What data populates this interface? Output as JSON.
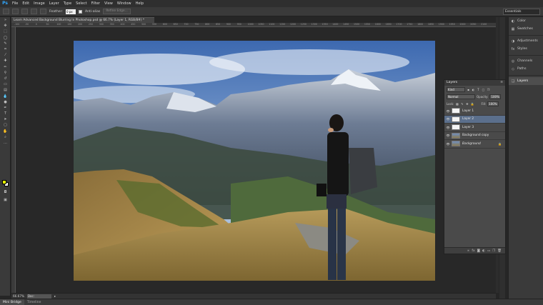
{
  "app": {
    "logo": "Ps",
    "menu": [
      "File",
      "Edit",
      "Image",
      "Layer",
      "Type",
      "Select",
      "Filter",
      "View",
      "Window",
      "Help"
    ]
  },
  "options": {
    "feather_label": "Feather:",
    "feather_value": "0 px",
    "antialias_label": "Anti-alias",
    "refine_label": "Refine Edge...",
    "workspace": "Essentials"
  },
  "document": {
    "tab_title": "Learn Advanced Background Blurring In Photoshop.psd @ 66.7% (Layer 1, RGB/8#) *",
    "ruler_ticks": [
      "-100",
      "-50",
      "0",
      "50",
      "100",
      "150",
      "200",
      "250",
      "300",
      "350",
      "400",
      "450",
      "500",
      "550",
      "600",
      "650",
      "700",
      "750",
      "800",
      "850",
      "900",
      "950",
      "1000",
      "1050",
      "1100",
      "1150",
      "1200",
      "1250",
      "1300",
      "1350",
      "1400",
      "1450",
      "1500",
      "1550",
      "1600",
      "1650",
      "1700",
      "1750",
      "1800",
      "1850",
      "1900",
      "1950",
      "2000",
      "2050",
      "2100"
    ]
  },
  "status": {
    "zoom": "66.67%",
    "doc": "Doc: 7.03M/22.1M"
  },
  "bottom_tabs": [
    "Mini Bridge",
    "Timeline"
  ],
  "dock": {
    "groups": [
      [
        "Color",
        "Swatches"
      ],
      [
        "Adjustments",
        "Styles"
      ],
      [
        "Channels",
        "Paths"
      ],
      [
        "Layers"
      ]
    ]
  },
  "layers": {
    "title": "Layers",
    "filter_kind": "Kind",
    "blend_mode": "Normal",
    "opacity_label": "Opacity:",
    "opacity_value": "100%",
    "lock_label": "Lock:",
    "fill_label": "Fill:",
    "fill_value": "100%",
    "items": [
      {
        "name": "Layer 1"
      },
      {
        "name": "Layer 2"
      },
      {
        "name": "Layer 3"
      },
      {
        "name": "Background copy"
      },
      {
        "name": "Background"
      }
    ]
  },
  "colors": {
    "foreground": "#e3f000",
    "background": "#ffffff",
    "selected_layer": "#5b6f8c",
    "ps_blue": "#31a8ff"
  }
}
